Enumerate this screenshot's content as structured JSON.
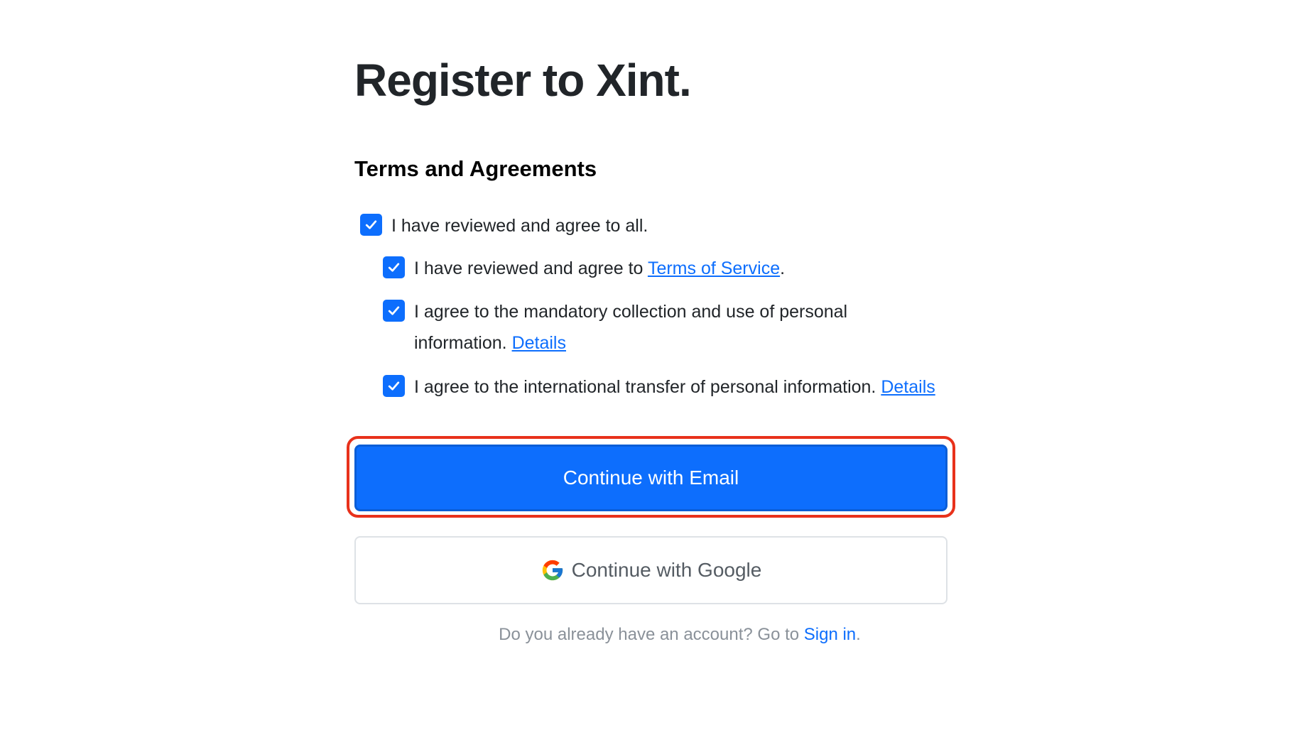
{
  "page": {
    "title": "Register to Xint."
  },
  "terms": {
    "section_title": "Terms and Agreements",
    "agree_all": {
      "checked": true,
      "label": "I have reviewed and agree to all."
    },
    "items": [
      {
        "checked": true,
        "text_before": "I have reviewed and agree to ",
        "link": "Terms of Service",
        "text_after": "."
      },
      {
        "checked": true,
        "text_before": "I agree to the mandatory collection and use of personal information. ",
        "link": "Details"
      },
      {
        "checked": true,
        "text_before": "I agree to the international transfer of personal information. ",
        "link": "Details"
      }
    ]
  },
  "buttons": {
    "email_label": "Continue with Email",
    "google_label": "Continue with Google"
  },
  "footer": {
    "text": "Do you already have an account? Go to ",
    "signin_link": "Sign in",
    "text_after": "."
  },
  "colors": {
    "primary": "#0d6efd",
    "highlight": "#e8311b",
    "text": "#212529",
    "muted": "#8a9199"
  },
  "icons": {
    "checkbox": "check-icon",
    "google": "google-logo-icon"
  }
}
